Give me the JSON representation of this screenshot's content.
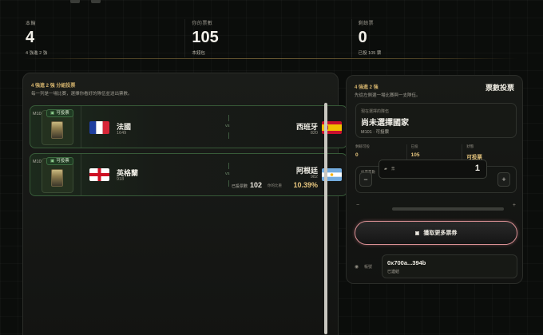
{
  "stats": [
    {
      "label": "本輪",
      "value": "4",
      "sub": "4 強進 2 強"
    },
    {
      "label": "你的票數",
      "value": "105",
      "sub": "本錢包"
    },
    {
      "label": "剩餘票",
      "value": "0",
      "sub": "已投 105 票"
    }
  ],
  "left_panel": {
    "title": "4 強進 2 強 分組投票",
    "subtitle": "每一列是一場比賽，選擇你看好的隊伍並送出票數。",
    "vs_label": "vs",
    "matches": [
      {
        "id": "M101",
        "badge": "可投票",
        "home": {
          "name": "法國",
          "count": "1649",
          "flag": "france"
        },
        "away": {
          "name": "西班牙",
          "count": "820",
          "flag": "spain"
        }
      },
      {
        "id": "M102",
        "badge": "可投票",
        "home": {
          "name": "英格蘭",
          "count": "918",
          "flag": "england"
        },
        "away": {
          "name": "阿根廷",
          "count": "982",
          "flag": "argentina"
        },
        "extra_label": "已投票數",
        "extra_value": "102",
        "pct_label": "你的比重",
        "pct_value": "10.39%"
      }
    ]
  },
  "right_panel": {
    "title": "4 強進 2 強",
    "subtitle": "先從左側選一場比賽與一支隊伍。",
    "heading": "票數投票",
    "selection": {
      "label": "現在選擇的隊伍",
      "value": "尚未選擇國家",
      "sub": "M101 · 可投票"
    },
    "info": [
      {
        "label": "剩餘可投",
        "value": "0",
        "style": "gold"
      },
      {
        "label": "已投",
        "value": "105",
        "style": "gold"
      },
      {
        "label": "狀態",
        "value": "可投票",
        "style": "gold"
      }
    ],
    "quantity": {
      "label": "投票票數",
      "unit": "票",
      "value": "1",
      "minus": "−",
      "plus": "+"
    },
    "slider_minus": "−",
    "slider_plus": "+",
    "buy_button": "獲取更多票券",
    "wallet": {
      "label": "帳號",
      "address": "0x700a...394b",
      "status": "已連結"
    }
  },
  "colors": {
    "accent_gold": "#d6b56e",
    "match_border": "#375a38",
    "buy_border": "#d88f93"
  }
}
